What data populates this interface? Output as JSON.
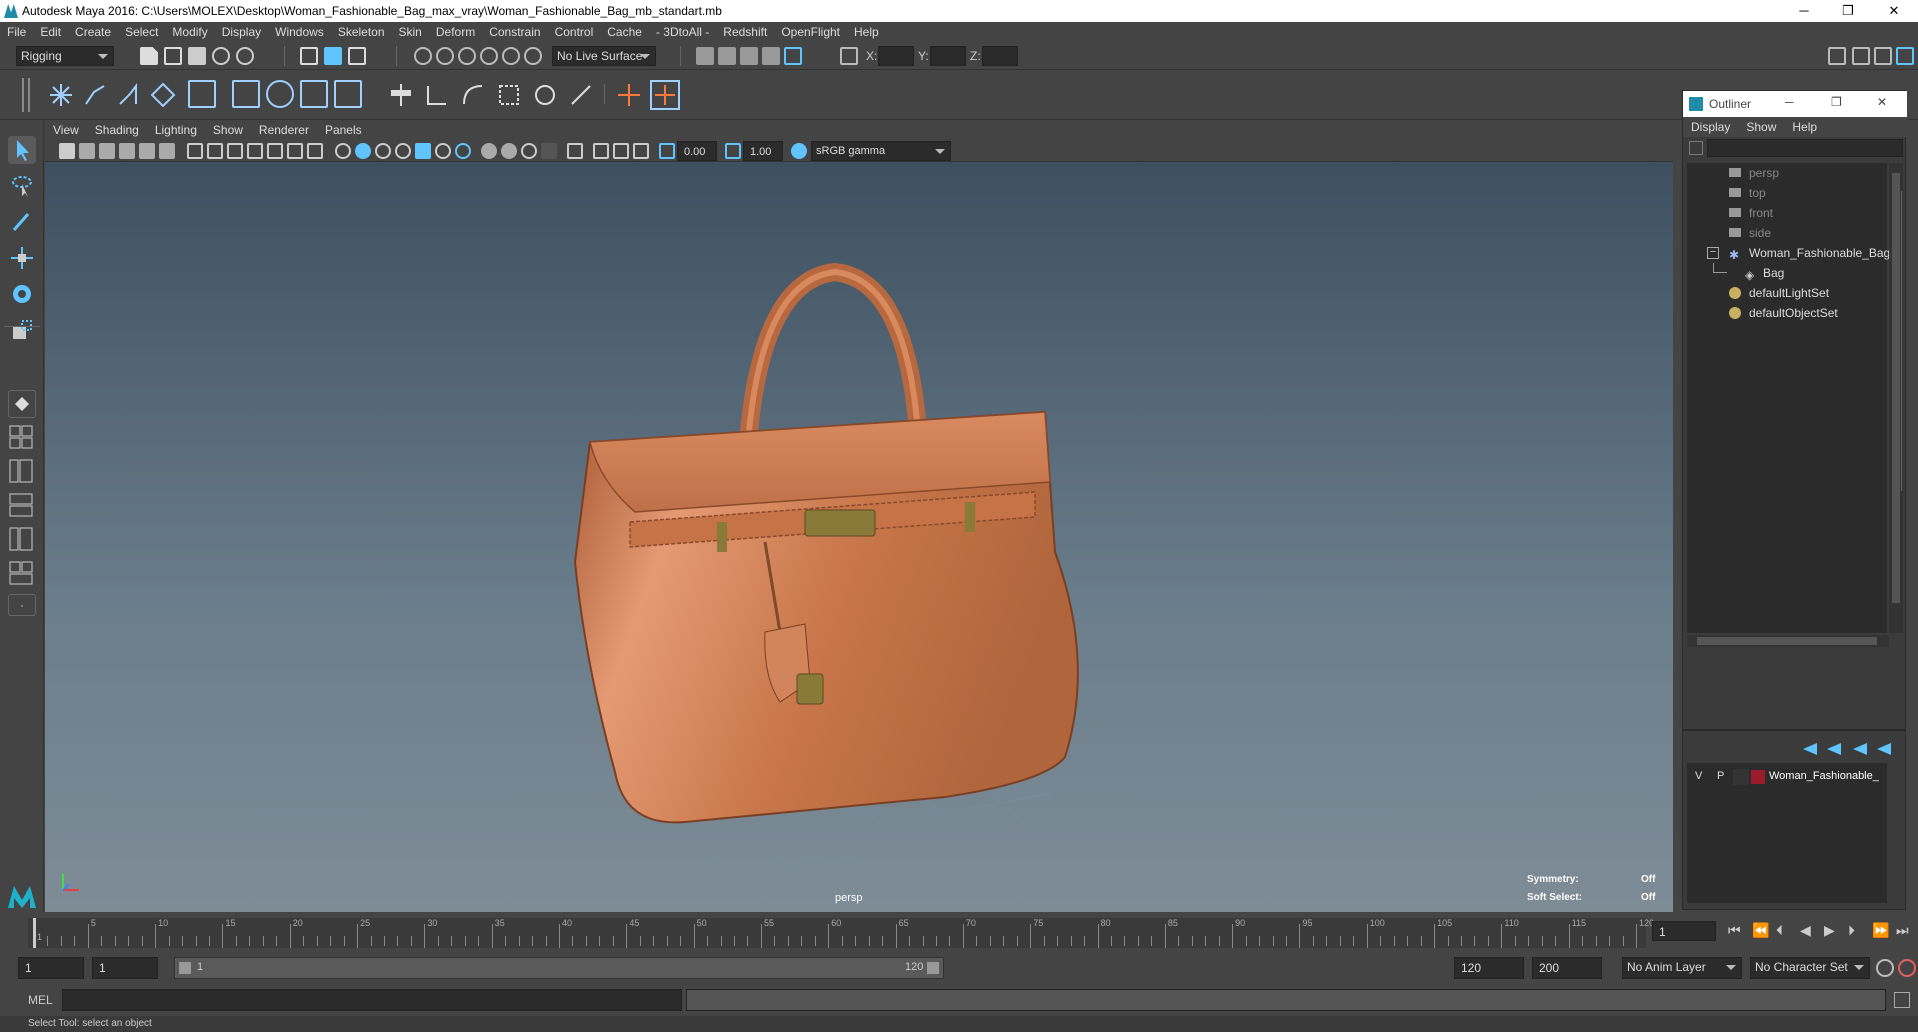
{
  "window": {
    "title": "Autodesk Maya 2016: C:\\Users\\MOLEX\\Desktop\\Woman_Fashionable_Bag_max_vray\\Woman_Fashionable_Bag_mb_standart.mb",
    "min": "─",
    "max": "❐",
    "close": "✕"
  },
  "menubar": [
    "File",
    "Edit",
    "Create",
    "Select",
    "Modify",
    "Display",
    "Windows",
    "Skeleton",
    "Skin",
    "Deform",
    "Constrain",
    "Control",
    "Cache",
    "- 3DtoAll -",
    "Redshift",
    "OpenFlight",
    "Help"
  ],
  "statusline": {
    "mode": "Rigging",
    "live_surface": "No Live Surface",
    "x_label": "X:",
    "y_label": "Y:",
    "z_label": "Z:"
  },
  "panel": {
    "menus": [
      "View",
      "Shading",
      "Lighting",
      "Show",
      "Renderer",
      "Panels"
    ],
    "exposure": "0.00",
    "gamma": "1.00",
    "colorspace": "sRGB gamma"
  },
  "viewport": {
    "camera": "persp",
    "symmetry_label": "Symmetry:",
    "symmetry_value": "Off",
    "soft_label": "Soft Select:",
    "soft_value": "Off"
  },
  "outliner": {
    "title": "Outliner",
    "menus": [
      "Display",
      "Show",
      "Help"
    ],
    "items": [
      "persp",
      "top",
      "front",
      "side",
      "Woman_Fashionable_Bag_n",
      "Bag",
      "defaultLightSet",
      "defaultObjectSet"
    ]
  },
  "layers": {
    "v": "V",
    "p": "P",
    "name": "Woman_Fashionable_",
    "color": "#9b1b2d"
  },
  "timeline": {
    "ticks": [
      "1",
      "5",
      "10",
      "15",
      "20",
      "25",
      "30",
      "35",
      "40",
      "45",
      "50",
      "55",
      "60",
      "65",
      "70",
      "75",
      "80",
      "85",
      "90",
      "95",
      "100",
      "105",
      "110",
      "115",
      "120"
    ],
    "current_frame": "1"
  },
  "range": {
    "start": "1",
    "play_start": "1",
    "slider_start": "1",
    "slider_end": "120",
    "play_end": "120",
    "end": "200",
    "anim_layer": "No Anim Layer",
    "char_set": "No Character Set"
  },
  "cmd": {
    "label": "MEL"
  },
  "help": "Select Tool: select an object",
  "colors": {
    "bag": "#c8764a",
    "accent": "#5fc4ff",
    "brass": "#a08040"
  }
}
